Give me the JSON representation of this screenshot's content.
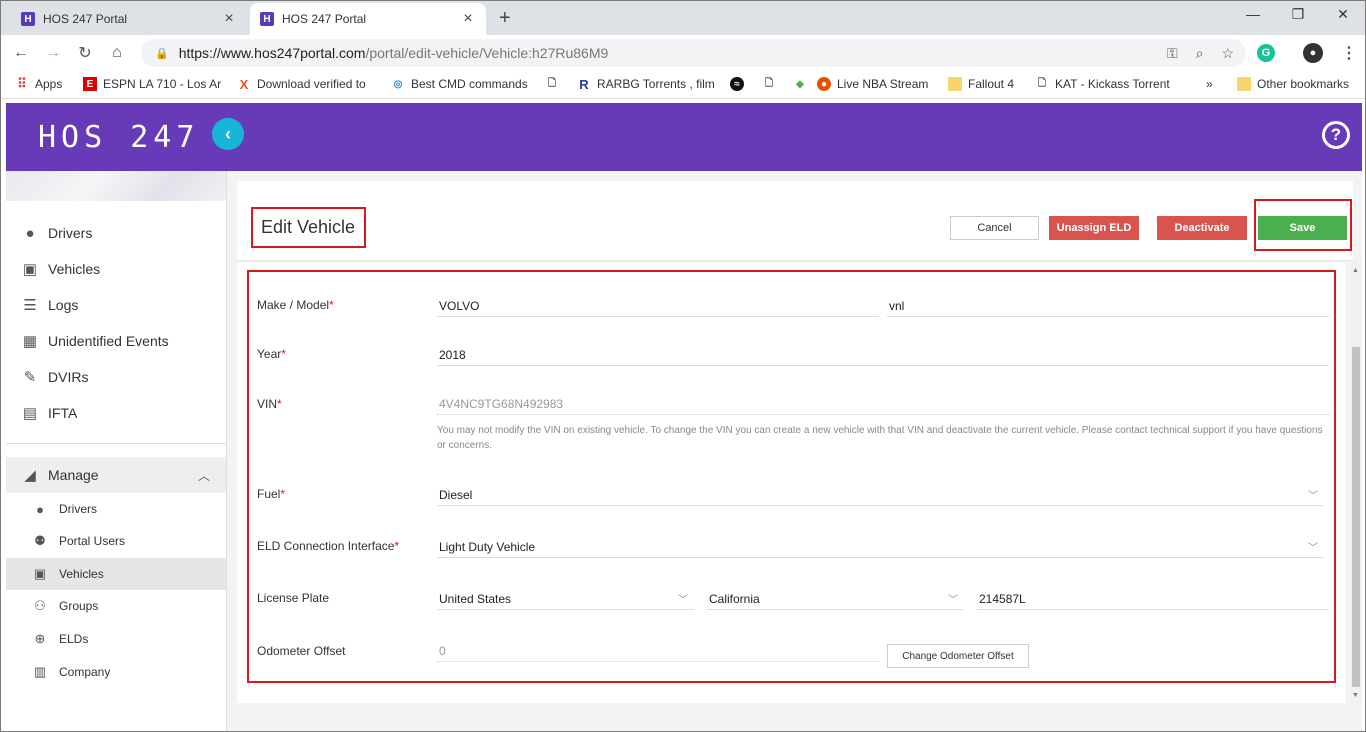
{
  "browser": {
    "tabs": [
      {
        "title": "HOS 247 Portal",
        "favicon": "H"
      },
      {
        "title": "HOS 247 Portal",
        "favicon": "H"
      }
    ],
    "url_host": "https://www.hos247portal.com",
    "url_path": "/portal/edit-vehicle/Vehicle:h27Ru86M9",
    "bookmarks": [
      {
        "label": "Apps",
        "icon": "apps-grid-icon"
      },
      {
        "label": "ESPN LA 710 - Los Ar",
        "icon": "espn-icon"
      },
      {
        "label": "Download verified to",
        "icon": "x-icon"
      },
      {
        "label": "Best CMD commands",
        "icon": "globe-icon"
      },
      {
        "label": "",
        "icon": "page-icon"
      },
      {
        "label": "RARBG Torrents , film",
        "icon": "r-icon"
      },
      {
        "label": "",
        "icon": "spotify-icon"
      },
      {
        "label": "",
        "icon": "page-icon"
      },
      {
        "label": "Live NBA Stream",
        "icon": "basketball-icon"
      },
      {
        "label": "Fallout 4",
        "icon": "folder-icon"
      },
      {
        "label": "KAT - Kickass Torrent",
        "icon": "page-icon"
      },
      {
        "label": "»",
        "icon": ""
      },
      {
        "label": "Other bookmarks",
        "icon": "folder-icon"
      }
    ]
  },
  "header": {
    "logo": "HOS 247",
    "collapse_glyph": "‹",
    "help_glyph": "?"
  },
  "sidebar": {
    "items": [
      {
        "label": "Drivers",
        "icon": "person-icon"
      },
      {
        "label": "Vehicles",
        "icon": "bus-icon"
      },
      {
        "label": "Logs",
        "icon": "list-icon"
      },
      {
        "label": "Unidentified Events",
        "icon": "calendar-icon"
      },
      {
        "label": "DVIRs",
        "icon": "wrench-icon"
      },
      {
        "label": "IFTA",
        "icon": "document-icon"
      }
    ],
    "manage": {
      "label": "Manage",
      "icon": "manage-icon",
      "expanded": true
    },
    "sub_items": [
      {
        "label": "Drivers",
        "icon": "person-icon"
      },
      {
        "label": "Portal Users",
        "icon": "users-icon"
      },
      {
        "label": "Vehicles",
        "icon": "bus-icon",
        "active": true
      },
      {
        "label": "Groups",
        "icon": "group-icon"
      },
      {
        "label": "ELDs",
        "icon": "eld-icon"
      },
      {
        "label": "Company",
        "icon": "building-icon"
      }
    ]
  },
  "page": {
    "title": "Edit Vehicle",
    "buttons": {
      "cancel": "Cancel",
      "unassign": "Unassign ELD",
      "deactivate": "Deactivate",
      "save": "Save"
    }
  },
  "form": {
    "make_model": {
      "label": "Make / Model",
      "make": "VOLVO",
      "model": "vnl"
    },
    "year": {
      "label": "Year",
      "value": "2018"
    },
    "vin": {
      "label": "VIN",
      "value": "4V4NC9TG68N492983",
      "help": "You may not modify the VIN on existing vehicle. To change the VIN you can create a new vehicle with that VIN and deactivate the current vehicle. Please contact technical support if you have questions or concerns."
    },
    "fuel": {
      "label": "Fuel",
      "value": "Diesel"
    },
    "eld_interface": {
      "label": "ELD Connection Interface",
      "value": "Light Duty Vehicle"
    },
    "license_plate": {
      "label": "License Plate",
      "country": "United States",
      "state": "California",
      "plate": "214587L"
    },
    "odometer": {
      "label": "Odometer Offset",
      "value": "0",
      "button": "Change Odometer Offset"
    },
    "required_mark": "*"
  },
  "colors": {
    "brand": "#673ab7",
    "accent": "#17b6d9",
    "danger": "#d9534f",
    "success": "#4caf50",
    "highlight": "#d71920"
  }
}
